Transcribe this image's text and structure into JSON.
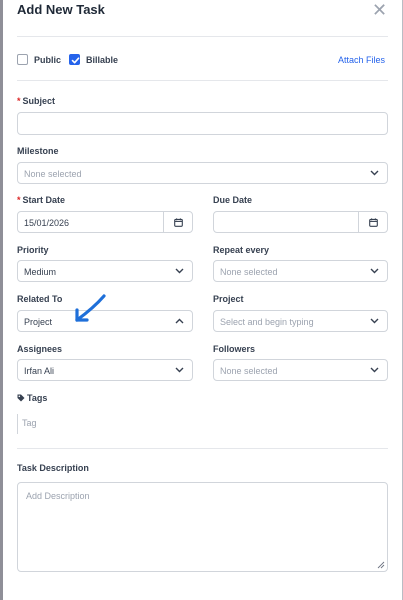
{
  "modal": {
    "title": "Add New Task",
    "close_icon": "close-icon"
  },
  "options": {
    "public_label": "Public",
    "public_checked": false,
    "billable_label": "Billable",
    "billable_checked": true,
    "attach_label": "Attach Files"
  },
  "form": {
    "subject": {
      "label": "Subject",
      "required": true,
      "value": ""
    },
    "milestone": {
      "label": "Milestone",
      "value": "None selected"
    },
    "start_date": {
      "label": "Start Date",
      "required": true,
      "value": "15/01/2026",
      "icon": "calendar-icon"
    },
    "due_date": {
      "label": "Due Date",
      "value": "",
      "icon": "calendar-icon"
    },
    "priority": {
      "label": "Priority",
      "value": "Medium"
    },
    "repeat_every": {
      "label": "Repeat every",
      "value": "None selected"
    },
    "related_to": {
      "label": "Related To",
      "value": "Project",
      "open": true
    },
    "project": {
      "label": "Project",
      "placeholder": "Select and begin typing"
    },
    "assignees": {
      "label": "Assignees",
      "value": "Irfan Ali"
    },
    "followers": {
      "label": "Followers",
      "value": "None selected"
    },
    "tags": {
      "label": "Tags",
      "icon": "tag-icon",
      "placeholder": "Tag"
    },
    "description": {
      "label": "Task Description",
      "placeholder": "Add Description"
    }
  },
  "annotation": {
    "icon": "arrow-icon",
    "color": "#1e6fd9"
  },
  "colors": {
    "accent": "#2563eb",
    "required": "#dc2626",
    "border": "#d1d5db"
  }
}
